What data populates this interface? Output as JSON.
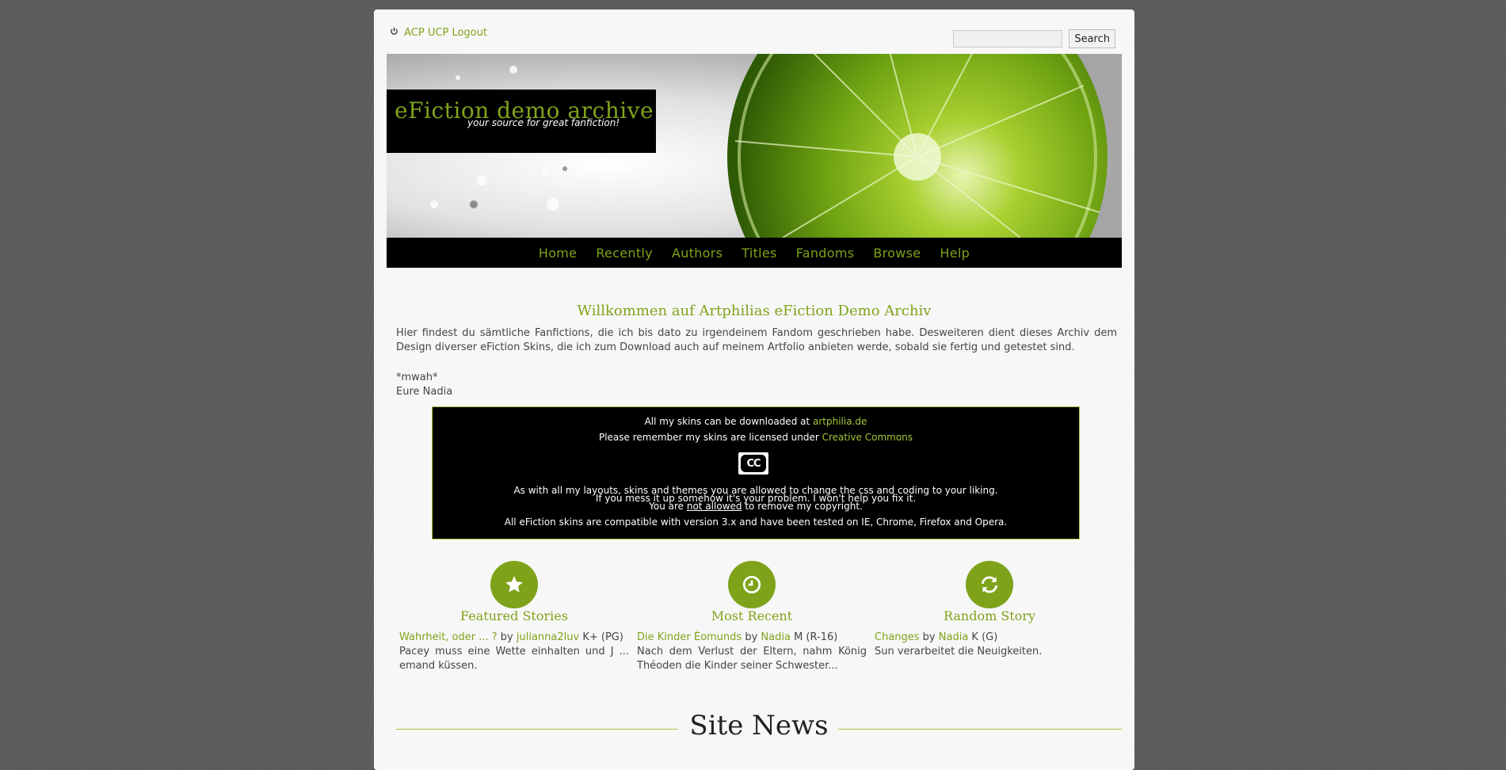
{
  "topbar": {
    "power_icon": "power-icon",
    "links": [
      "ACP",
      "UCP",
      "Logout"
    ],
    "search_button": "Search",
    "search_value": ""
  },
  "header": {
    "title": "eFiction demo archive",
    "slogan": "your source for great fanfiction!"
  },
  "nav": [
    "Home",
    "Recently",
    "Authors",
    "Titles",
    "Fandoms",
    "Browse",
    "Help"
  ],
  "welcome": {
    "title": "Willkommen auf Artphilias eFiction Demo Archiv",
    "text": "Hier findest du sämtliche Fanfictions, die ich bis dato zu irgendeinem Fandom geschrieben habe. Desweiteren dient dieses Archiv dem Design diverser eFiction Skins, die ich zum Download auch auf meinem Artfolio anbieten werde, sobald sie fertig und getestet sind.",
    "sign1": "*mwah*",
    "sign2": "Eure Nadia"
  },
  "notice": {
    "line1_pre": "All my skins can be downloaded at ",
    "line1_link": "artphilia.de",
    "line2_pre": "Please remember my skins are licensed under ",
    "line2_link": "Creative Commons",
    "cc_badge": "CC",
    "line3": "As with all my layouts, skins and themes you are allowed to change the css and coding to your liking.",
    "line4": "If you mess it up somehow it's your problem. I won't help you fix it.",
    "line5_pre": "You are ",
    "line5_u": "not allowed",
    "line5_post": " to remove my copyright.",
    "line6": "All eFiction skins are compatible with version 3.x and have been tested on IE, Chrome, Firefox and Opera."
  },
  "blocks": [
    {
      "icon": "star-icon",
      "title": "Featured Stories",
      "story": "Wahrheit, oder ... ?",
      "by": " by ",
      "author": "julianna2luv",
      "rating": " K+ (PG)",
      "summary": "Pacey muss eine Wette einhalten und J ... emand küssen."
    },
    {
      "icon": "clock-icon",
      "title": "Most Recent",
      "story": "Die Kinder Éomunds",
      "by": " by ",
      "author": "Nadia",
      "rating": " M (R-16)",
      "summary": "Nach dem Verlust der Eltern, nahm König Théoden die Kinder seiner Schwester..."
    },
    {
      "icon": "refresh-icon",
      "title": "Random Story",
      "story": "Changes",
      "by": " by ",
      "author": "Nadia",
      "rating": " K (G)",
      "summary": "Sun verarbeitet die Neuigkeiten."
    }
  ],
  "site_news": {
    "title": "Site News"
  },
  "colors": {
    "accent": "#7ea31a",
    "border": "#a4c639",
    "background": "#5c5c5c",
    "panel": "#f7f7f7"
  }
}
